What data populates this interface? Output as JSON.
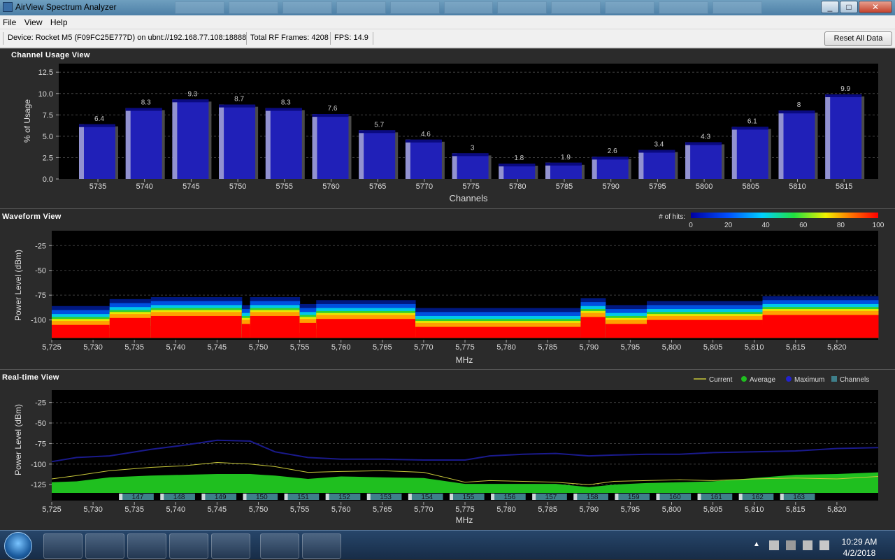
{
  "window": {
    "title": "AirView Spectrum Analyzer"
  },
  "menu": [
    "File",
    "View",
    "Help"
  ],
  "info": {
    "device": "Device: Rocket M5 (F09FC25E777D) on ubnt://192.168.77.108:18888",
    "frames": "Total RF Frames: 4208",
    "fps": "FPS: 14.9",
    "reset_label": "Reset All Data"
  },
  "channel_usage": {
    "title": "Channel Usage View",
    "ylabel": "% of Usage",
    "xlabel": "Channels",
    "yticks": [
      "12.5",
      "10.0",
      "7.5",
      "5.0",
      "2.5",
      "0.0"
    ]
  },
  "waveform": {
    "title": "Waveform View",
    "ylabel": "Power Level (dBm)",
    "xlabel": "MHz",
    "yticks": [
      "-25",
      "-50",
      "-75",
      "-100"
    ],
    "legend_title": "# of hits:",
    "legend_ticks": [
      "0",
      "20",
      "40",
      "60",
      "80",
      "100"
    ]
  },
  "realtime": {
    "title": "Real-time View",
    "ylabel": "Power Level (dBm)",
    "xlabel": "MHz",
    "yticks": [
      "-25",
      "-50",
      "-75",
      "-100",
      "-125"
    ],
    "legend": [
      "Current",
      "Average",
      "Maximum",
      "Channels"
    ],
    "channel_labels": [
      "147",
      "148",
      "149",
      "150",
      "151",
      "152",
      "153",
      "154",
      "155",
      "156",
      "157",
      "158",
      "159",
      "160",
      "161",
      "162",
      "163"
    ],
    "colors": {
      "current": "#c8c83a",
      "average": "#1fbf1f",
      "maximum": "#1a1a8c",
      "channels": "#3e7f8a"
    }
  },
  "mhz_ticks": [
    "5,725",
    "5,730",
    "5,735",
    "5,740",
    "5,745",
    "5,750",
    "5,755",
    "5,760",
    "5,765",
    "5,770",
    "5,775",
    "5,780",
    "5,785",
    "5,790",
    "5,795",
    "5,800",
    "5,805",
    "5,810",
    "5,815",
    "5,820"
  ],
  "chart_data": [
    {
      "type": "bar",
      "title": "Channel Usage View",
      "xlabel": "Channels",
      "ylabel": "% of Usage",
      "categories": [
        "5735",
        "5740",
        "5745",
        "5750",
        "5755",
        "5760",
        "5765",
        "5770",
        "5775",
        "5780",
        "5785",
        "5790",
        "5795",
        "5800",
        "5805",
        "5810",
        "5815"
      ],
      "values": [
        6.4,
        8.3,
        9.3,
        8.7,
        8.3,
        7.6,
        5.7,
        4.6,
        3,
        1.8,
        1.9,
        2.6,
        3.4,
        4.3,
        6.1,
        8,
        9.9
      ],
      "ylim": [
        0,
        13.5
      ],
      "grid": true
    },
    {
      "type": "heatmap",
      "title": "Waveform View",
      "xlabel": "MHz",
      "ylabel": "Power Level (dBm)",
      "xlim": [
        5725,
        5825
      ],
      "ylim": [
        -120,
        -10
      ],
      "colorbar": {
        "label": "# of hits:",
        "range": [
          0,
          100
        ]
      },
      "segments": [
        {
          "from": 5725,
          "to": 5732,
          "floor": -105
        },
        {
          "from": 5732,
          "to": 5737,
          "floor": -98
        },
        {
          "from": 5737,
          "to": 5748,
          "floor": -96
        },
        {
          "from": 5748,
          "to": 5749,
          "floor": -104
        },
        {
          "from": 5749,
          "to": 5755,
          "floor": -96
        },
        {
          "from": 5755,
          "to": 5757,
          "floor": -103
        },
        {
          "from": 5757,
          "to": 5769,
          "floor": -99
        },
        {
          "from": 5769,
          "to": 5789,
          "floor": -107
        },
        {
          "from": 5789,
          "to": 5792,
          "floor": -97
        },
        {
          "from": 5792,
          "to": 5797,
          "floor": -104
        },
        {
          "from": 5797,
          "to": 5811,
          "floor": -100
        },
        {
          "from": 5811,
          "to": 5825,
          "floor": -95
        }
      ]
    },
    {
      "type": "line",
      "title": "Real-time View",
      "xlabel": "MHz",
      "ylabel": "Power Level (dBm)",
      "xlim": [
        5725,
        5825
      ],
      "ylim": [
        -135,
        -10
      ],
      "series": [
        {
          "name": "Maximum",
          "x": [
            5725,
            5728,
            5732,
            5737,
            5741,
            5745,
            5749,
            5752,
            5756,
            5760,
            5765,
            5770,
            5775,
            5778,
            5782,
            5786,
            5790,
            5793,
            5797,
            5801,
            5805,
            5810,
            5815,
            5820,
            5825
          ],
          "values": [
            -97,
            -92,
            -90,
            -82,
            -77,
            -71,
            -72,
            -85,
            -92,
            -94,
            -94,
            -95,
            -95,
            -90,
            -88,
            -87,
            -90,
            -89,
            -88,
            -88,
            -86,
            -85,
            -84,
            -81,
            -80
          ]
        },
        {
          "name": "Average",
          "x": [
            5725,
            5728,
            5732,
            5737,
            5741,
            5745,
            5749,
            5752,
            5756,
            5760,
            5765,
            5770,
            5775,
            5778,
            5782,
            5786,
            5790,
            5793,
            5797,
            5801,
            5805,
            5810,
            5815,
            5820,
            5825
          ],
          "values": [
            -122,
            -121,
            -116,
            -114,
            -113,
            -112,
            -112,
            -114,
            -118,
            -115,
            -116,
            -117,
            -124,
            -124,
            -124,
            -124,
            -128,
            -125,
            -123,
            -122,
            -121,
            -117,
            -113,
            -112,
            -110
          ]
        },
        {
          "name": "Current",
          "x": [
            5725,
            5728,
            5732,
            5737,
            5741,
            5745,
            5749,
            5752,
            5756,
            5760,
            5765,
            5770,
            5775,
            5778,
            5782,
            5786,
            5790,
            5793,
            5797,
            5801,
            5805,
            5810,
            5815,
            5820,
            5825
          ],
          "values": [
            -118,
            -114,
            -108,
            -104,
            -102,
            -98,
            -100,
            -103,
            -110,
            -109,
            -108,
            -110,
            -122,
            -120,
            -121,
            -122,
            -125,
            -121,
            -120,
            -119,
            -120,
            -118,
            -117,
            -118,
            -115
          ]
        }
      ]
    }
  ]
}
